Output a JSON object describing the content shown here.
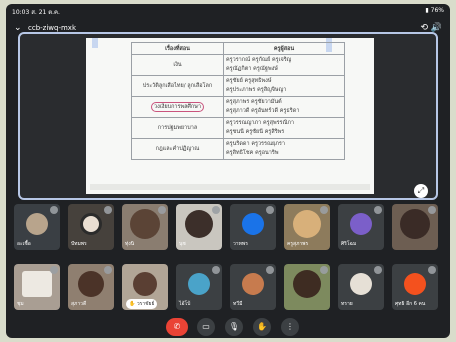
{
  "status": {
    "time": "10:03",
    "date": "ส. 21 ต.ค.",
    "battery": "76%"
  },
  "meeting": {
    "code": "ccb-ziwq-mxk"
  },
  "doc": {
    "headers": {
      "activity": "เรื่องที่สอน",
      "teachers": "ครูผู้สอน"
    },
    "rows": [
      {
        "activity": "เงิน",
        "teachers": "ครูวรากณ์ ครูกัณย์ ครูเจริญ\nครูณัฏกิตา ครูณัฐพงษ์"
      },
      {
        "activity": "ประวัติลูกเสือไทย/ ลูกเสือโลก",
        "teachers": "ครูชัยย์ ครูสุทธิพงษ์\nครูประภาพร ครูสิญจิษญา"
      },
      {
        "activity": "วงเงียบการพลศึกษา",
        "teachers": "ครูสุภาพร ครูชัยวามันต์\nครูสุภาวดี ครูอันทร์วดี ครูธริดา"
      },
      {
        "activity": "การปฐมพยาบาล",
        "teachers": "ครูวรรณญาภา ครูสุพรรณิกา\nครูชนนี ครูชัยนี ครูสิริพร"
      },
      {
        "activity": "กฎและคำปฏิญาณ",
        "teachers": "ครูนริดดา ครูวรรณยุภรา\nครูสิทธิโชค ครูอนาริพ"
      }
    ]
  },
  "participants": [
    {
      "name": "อะเชื้อ"
    },
    {
      "name": "ปัทมพร"
    },
    {
      "name": "ทุ่งนิ"
    },
    {
      "name": "นุช"
    },
    {
      "name": "วาทพร"
    },
    {
      "name": "ครูสุภาพร"
    },
    {
      "name": "ศิริโฉม"
    },
    {
      "name": ""
    },
    {
      "name": "ชุม"
    },
    {
      "name": "สุภาวดี"
    },
    {
      "name": "วราชัยย์"
    },
    {
      "name": "ไอ้โบ้"
    },
    {
      "name": "ทวีมี"
    },
    {
      "name": ""
    },
    {
      "name": "ทราย"
    },
    {
      "name": "ศุทธิ อีก 6 คน"
    }
  ],
  "colors": {
    "end_call": "#ea4335",
    "share_border": "#b7c7e6",
    "tile_bg": "#3c4043"
  },
  "icons": {
    "chevron": "chevron-down-icon",
    "camera_flip": "camera-flip-icon",
    "speaker": "speaker-icon",
    "fullscreen": "fullscreen-icon",
    "end_call": "end-call-icon",
    "video": "video-icon",
    "mic": "mic-icon",
    "hand": "raise-hand-icon",
    "more": "more-vert-icon"
  }
}
